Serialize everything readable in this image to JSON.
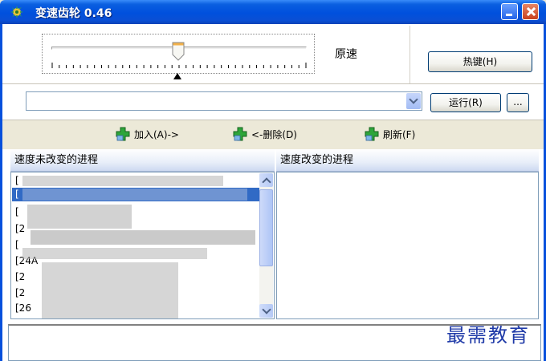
{
  "window": {
    "title": "变速齿轮 0.46"
  },
  "speed": {
    "label": "原速",
    "slider_level_fraction": 0.5
  },
  "buttons": {
    "hotkey": "热键(H)",
    "run": "运行(R)",
    "more": "..."
  },
  "process_combo": {
    "value": ""
  },
  "actions": {
    "add": "加入(A)->",
    "remove": "<-删除(D)",
    "refresh": "刷新(F)"
  },
  "lists": {
    "unchanged_header": "速度未改变的进程",
    "changed_header": "速度改变的进程",
    "unchanged_items": [
      "[",
      "[",
      "[",
      "[2",
      "[",
      "[24A",
      "[2",
      "[2",
      "[26"
    ]
  },
  "watermark": "最需教育",
  "colors": {
    "titlebar": "#0050dd",
    "accent": "#316ac5",
    "plus_icon": "#2da53a"
  }
}
